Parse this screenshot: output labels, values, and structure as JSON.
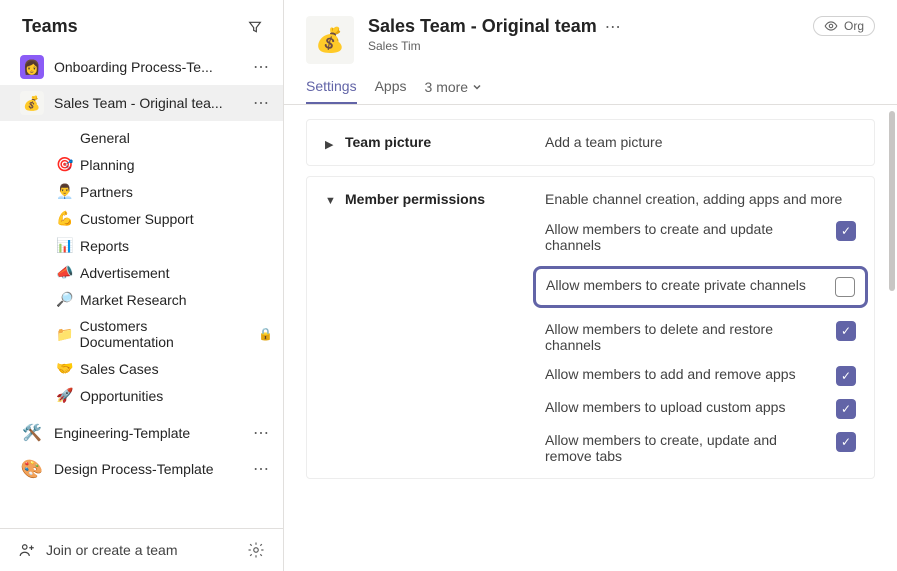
{
  "sidebar": {
    "title": "Teams",
    "teams": [
      {
        "label": "Onboarding Process-Te..."
      },
      {
        "label": "Sales Team - Original tea..."
      },
      {
        "label": "Engineering-Template"
      },
      {
        "label": "Design Process-Template"
      }
    ],
    "channels": [
      {
        "emoji": "",
        "label": "General"
      },
      {
        "emoji": "🎯",
        "label": "Planning"
      },
      {
        "emoji": "👨‍💼",
        "label": "Partners"
      },
      {
        "emoji": "💪",
        "label": "Customer Support"
      },
      {
        "emoji": "📊",
        "label": "Reports"
      },
      {
        "emoji": "📣",
        "label": "Advertisement"
      },
      {
        "emoji": "🔎",
        "label": "Market Research"
      },
      {
        "emoji": "📁",
        "label": "Customers Documentation",
        "locked": true
      },
      {
        "emoji": "🤝",
        "label": "Sales Cases"
      },
      {
        "emoji": "🚀",
        "label": "Opportunities"
      }
    ],
    "join_label": "Join or create a team"
  },
  "header": {
    "title": "Sales Team - Original team",
    "subtitle": "Sales Tim",
    "org_label": "Org"
  },
  "tabs": {
    "settings": "Settings",
    "apps": "Apps",
    "more": "3 more"
  },
  "sections": {
    "pic_title": "Team picture",
    "pic_desc": "Add a team picture",
    "perm_title": "Member permissions",
    "perm_desc": "Enable channel creation, adding apps and more"
  },
  "perms": [
    {
      "label": "Allow members to create and update channels",
      "checked": true
    },
    {
      "label": "Allow members to create private channels",
      "checked": false,
      "highlight": true
    },
    {
      "label": "Allow members to delete and restore channels",
      "checked": true
    },
    {
      "label": "Allow members to add and remove apps",
      "checked": true
    },
    {
      "label": "Allow members to upload custom apps",
      "checked": true
    },
    {
      "label": "Allow members to create, update and remove tabs",
      "checked": true
    }
  ]
}
